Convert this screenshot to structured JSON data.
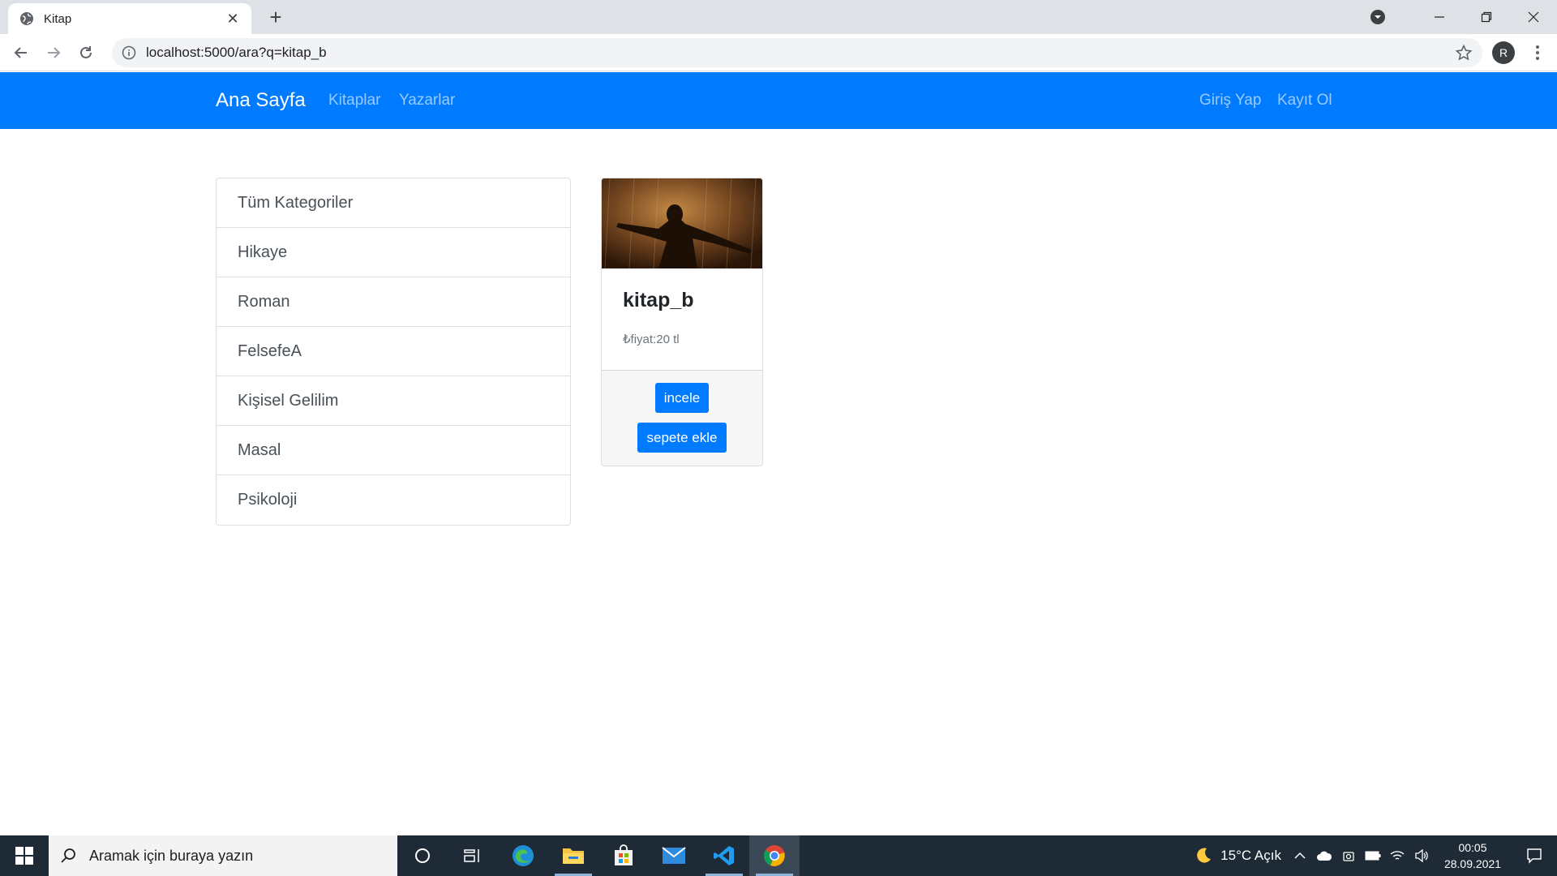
{
  "browser": {
    "tab_title": "Kitap",
    "tab_close": "✕",
    "new_tab": "+",
    "url": "localhost:5000/ara?q=kitap_b",
    "profile_initial": "R"
  },
  "navbar": {
    "brand": "Ana Sayfa",
    "links": [
      "Kitaplar",
      "Yazarlar"
    ],
    "auth": [
      "Giriş Yap",
      "Kayıt Ol"
    ],
    "color": "#007bff"
  },
  "categories": [
    "Tüm Kategoriler",
    "Hikaye",
    "Roman",
    "FelsefeA",
    "Kişisel Gelilim",
    "Masal",
    "Psikoloji"
  ],
  "product": {
    "title": "kitap_b",
    "price": "₺fiyat:20 tl",
    "buttons": [
      "incele",
      "sepete ekle"
    ]
  },
  "taskbar": {
    "search_placeholder": "Aramak için buraya yazın",
    "weather": "15°C  Açık",
    "time": "00:05",
    "date": "28.09.2021"
  }
}
